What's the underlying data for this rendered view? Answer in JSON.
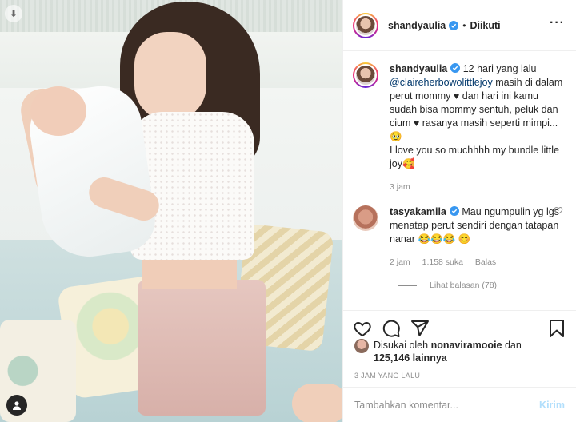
{
  "post": {
    "author": "shandyaulia",
    "follow_status": "Diikuti",
    "caption": {
      "author": "shandyaulia",
      "text_before_mention": " 12 hari yang lalu ",
      "mention": "@claireherbowolittlejoy",
      "text_after_mention": " masih di dalam perut mommy ♥ dan hari ini kamu sudah bisa mommy sentuh, peluk dan cium ♥ rasanya masih seperti mimpi... 🥹",
      "line2": "I love you so muchhhh my bundle little joy🥰",
      "time": "3 jam"
    },
    "comment": {
      "author": "tasyakamila",
      "text": " Mau ngumpulin yg lgs menatap perut sendiri dengan tatapan nanar 😂😂😂 😊",
      "time": "2 jam",
      "likes": "1.158 suka",
      "reply": "Balas",
      "view_replies": "Lihat balasan (78)"
    },
    "liked_by": {
      "prefix": "Disukai oleh ",
      "user": "nonaviramooie",
      "mid": " dan ",
      "count": "125,146",
      "suffix": " lainnya"
    },
    "timestamp": "3 JAM YANG LALU",
    "add_comment_placeholder": "Tambahkan komentar...",
    "post_button": "Kirim"
  },
  "icons": {
    "verified": "verified-badge-icon",
    "more": "more-options-icon",
    "like": "heart-icon",
    "comment": "comment-icon",
    "share": "share-icon",
    "save": "bookmark-icon"
  },
  "colors": {
    "verified": "#3897f0",
    "link": "#00376b",
    "muted": "#8e8e8e",
    "post_button": "#b2dffc"
  }
}
